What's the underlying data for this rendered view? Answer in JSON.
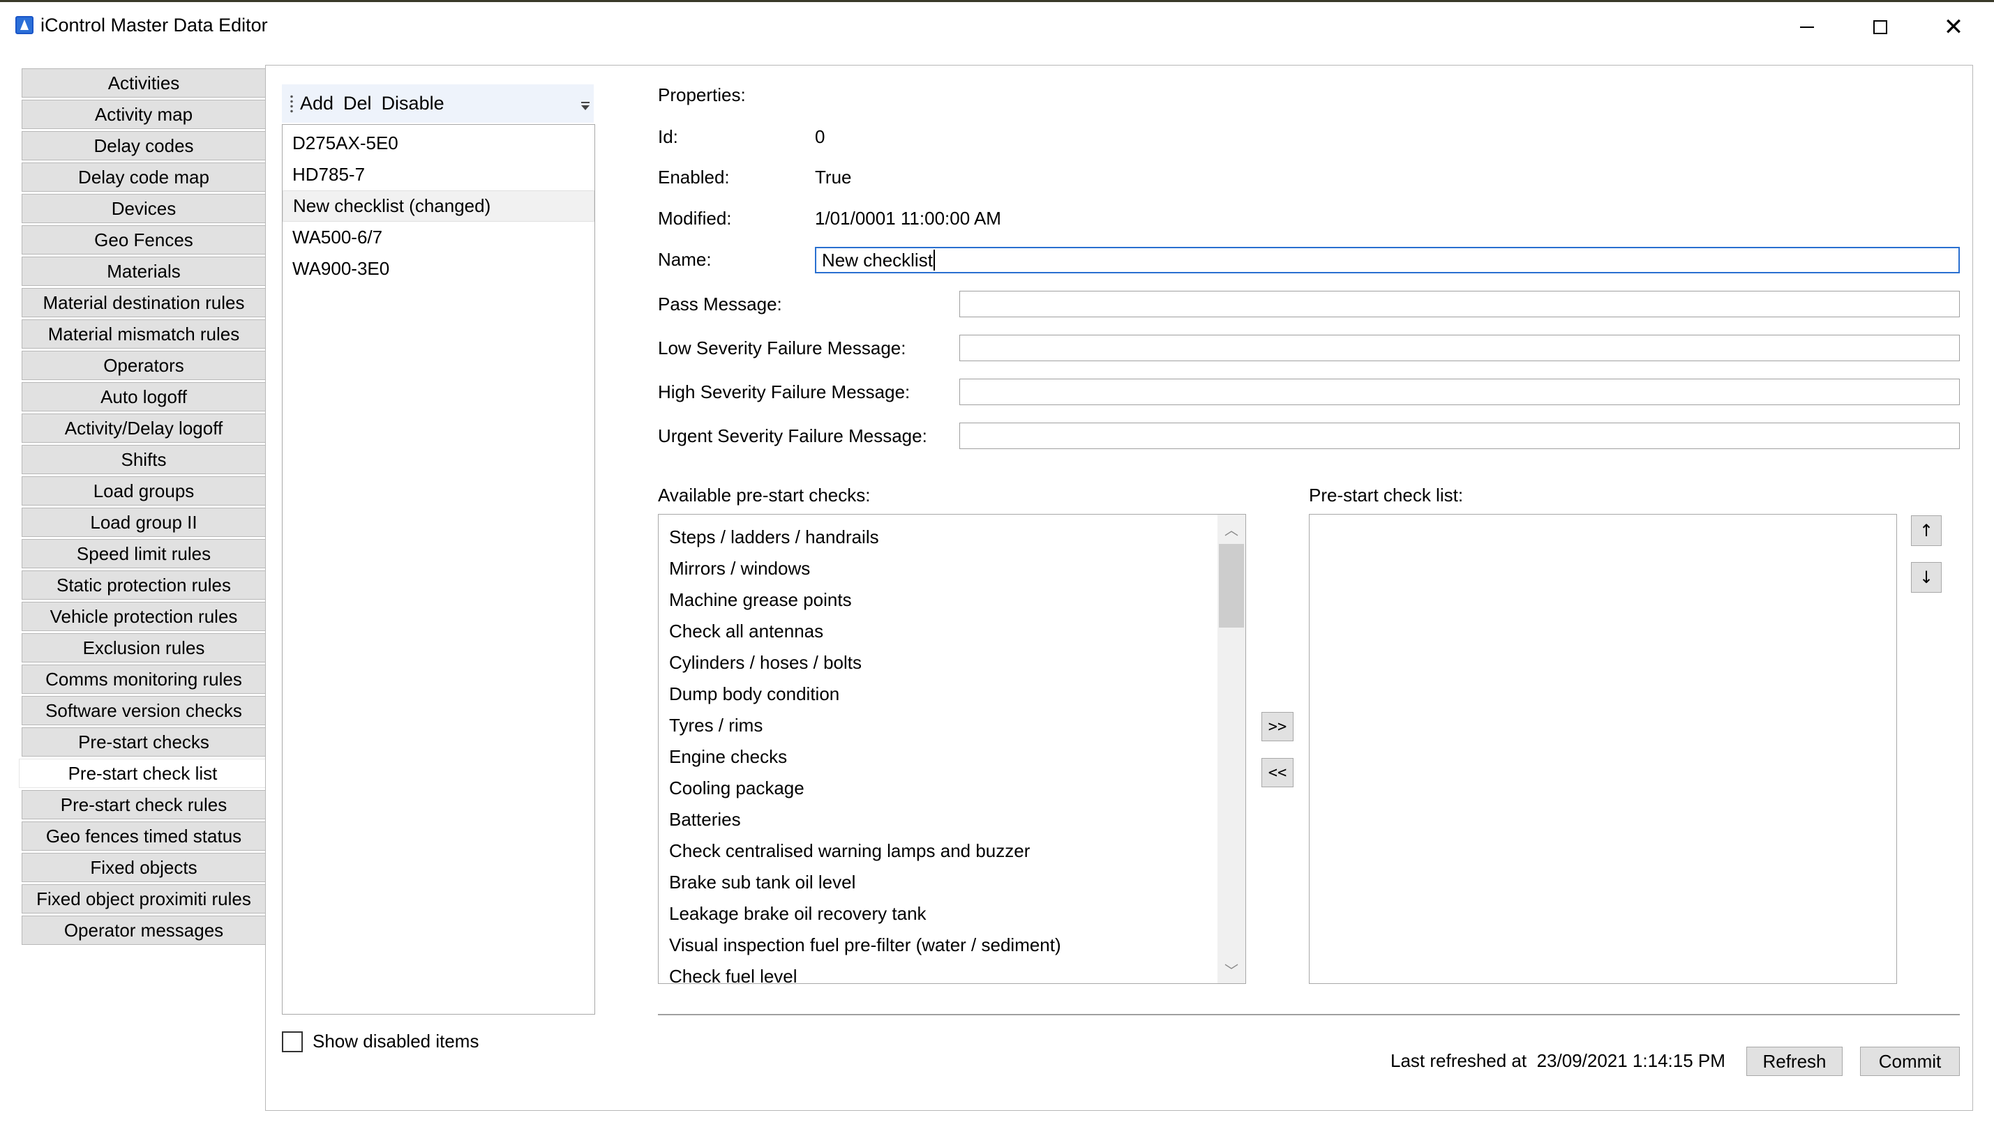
{
  "window": {
    "title": "iControl Master Data Editor",
    "minimize_glyph": "",
    "close_glyph": "✕"
  },
  "nav": {
    "items": [
      "Activities",
      "Activity map",
      "Delay codes",
      "Delay code map",
      "Devices",
      "Geo Fences",
      "Materials",
      "Material destination rules",
      "Material mismatch rules",
      "Operators",
      "Auto logoff",
      "Activity/Delay logoff",
      "Shifts",
      "Load groups",
      "Load group II",
      "Speed limit rules",
      "Static protection rules",
      "Vehicle protection rules",
      "Exclusion rules",
      "Comms monitoring rules",
      "Software version checks",
      "Pre-start checks",
      "Pre-start check list",
      "Pre-start check rules",
      "Geo fences timed status",
      "Fixed objects",
      "Fixed object proximiti rules",
      "Operator messages"
    ],
    "active_index": 22
  },
  "toolbar": {
    "add_label": "Add",
    "del_label": "Del",
    "disable_label": "Disable"
  },
  "checklists": {
    "items": [
      "D275AX-5E0",
      "HD785-7",
      "New checklist (changed)",
      "WA500-6/7",
      "WA900-3E0"
    ],
    "selected_index": 2
  },
  "show_disabled": {
    "label": "Show disabled items",
    "checked": false
  },
  "properties": {
    "header": "Properties:",
    "id_label": "Id:",
    "id_value": "0",
    "enabled_label": "Enabled:",
    "enabled_value": "True",
    "modified_label": "Modified:",
    "modified_value": "1/01/0001 11:00:00 AM",
    "name_label": "Name:",
    "name_value": "New checklist",
    "pass_label": "Pass Message:",
    "pass_value": "",
    "low_label": "Low Severity Failure Message:",
    "low_value": "",
    "high_label": "High Severity Failure Message:",
    "high_value": "",
    "urgent_label": "Urgent Severity Failure Message:",
    "urgent_value": ""
  },
  "available": {
    "label": "Available pre-start checks:",
    "items": [
      "Steps / ladders / handrails",
      "Mirrors / windows",
      "Machine grease points",
      "Check all antennas",
      "Cylinders / hoses / bolts",
      "Dump body condition",
      "Tyres / rims",
      "Engine checks",
      "Cooling package",
      "Batteries",
      "Check centralised warning lamps and buzzer",
      "Brake sub tank oil level",
      "Leakage brake oil recovery tank",
      "Visual inspection fuel pre-filter (water / sediment)",
      "Check fuel level"
    ]
  },
  "transfer": {
    "add_label": ">>",
    "remove_label": "<<"
  },
  "checklist_target": {
    "label": "Pre-start check list:",
    "items": []
  },
  "order": {
    "up_label": "↑",
    "down_label": "↓"
  },
  "footer": {
    "last_refreshed_label": "Last refreshed at",
    "last_refreshed_value": "23/09/2021 1:14:15 PM",
    "refresh_label": "Refresh",
    "commit_label": "Commit"
  }
}
